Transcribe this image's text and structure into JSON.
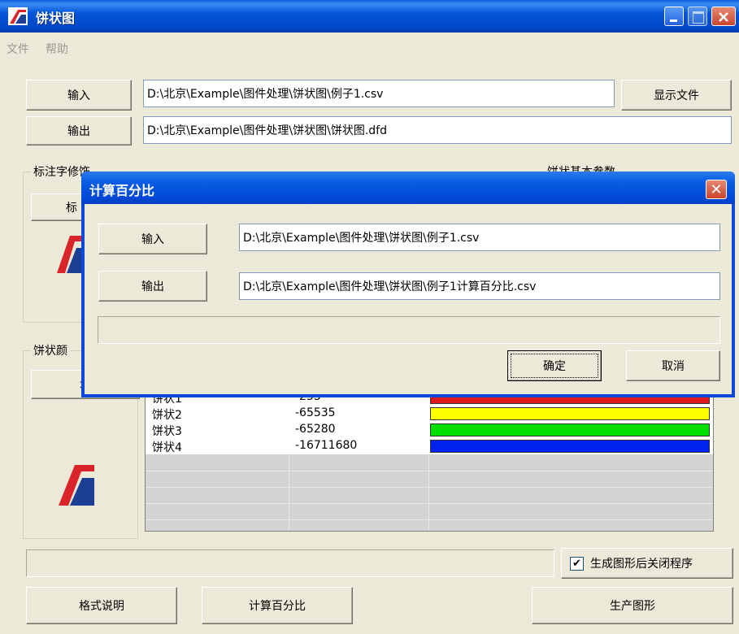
{
  "window": {
    "title": "饼状图"
  },
  "menu": [
    "文件",
    "帮助"
  ],
  "top": {
    "input_label": "输入",
    "input_path": "D:\\北京\\Example\\图件处理\\饼状图\\例子1.csv",
    "show_file_label": "显示文件",
    "output_label": "输出",
    "output_path": "D:\\北京\\Example\\图件处理\\饼状图\\饼状图.dfd"
  },
  "groups": {
    "label_decoration": "标注字修饰",
    "label_button_partial": "标",
    "pie_basic_params": "饼状基本参数",
    "pie_color": "饼状颜",
    "add_button_partial": "增"
  },
  "grid": {
    "rows": [
      {
        "name": "饼状1",
        "value": "-255",
        "color": "#e0191e"
      },
      {
        "name": "饼状2",
        "value": "-65535",
        "color": "#ffff00"
      },
      {
        "name": "饼状3",
        "value": "-65280",
        "color": "#00e000"
      },
      {
        "name": "饼状4",
        "value": "-16711680",
        "color": "#0022ee"
      }
    ]
  },
  "bottom": {
    "close_after_checkbox": "生成图形后关闭程序",
    "checked": true,
    "format_button": "格式说明",
    "calc_percent_button": "计算百分比",
    "generate_button": "生产图形"
  },
  "dialog": {
    "title": "计算百分比",
    "input_label": "输入",
    "input_path": "D:\\北京\\Example\\图件处理\\饼状图\\例子1.csv",
    "output_label": "输出",
    "output_path": "D:\\北京\\Example\\图件处理\\饼状图\\例子1计算百分比.csv",
    "ok_label": "确定",
    "cancel_label": "取消"
  },
  "colors": {
    "titlebar": "#0054e3",
    "face": "#ece9d8"
  },
  "icons": {
    "app": "app-logo-icon",
    "min": "minimize-icon",
    "max": "maximize-icon",
    "close": "close-icon"
  }
}
